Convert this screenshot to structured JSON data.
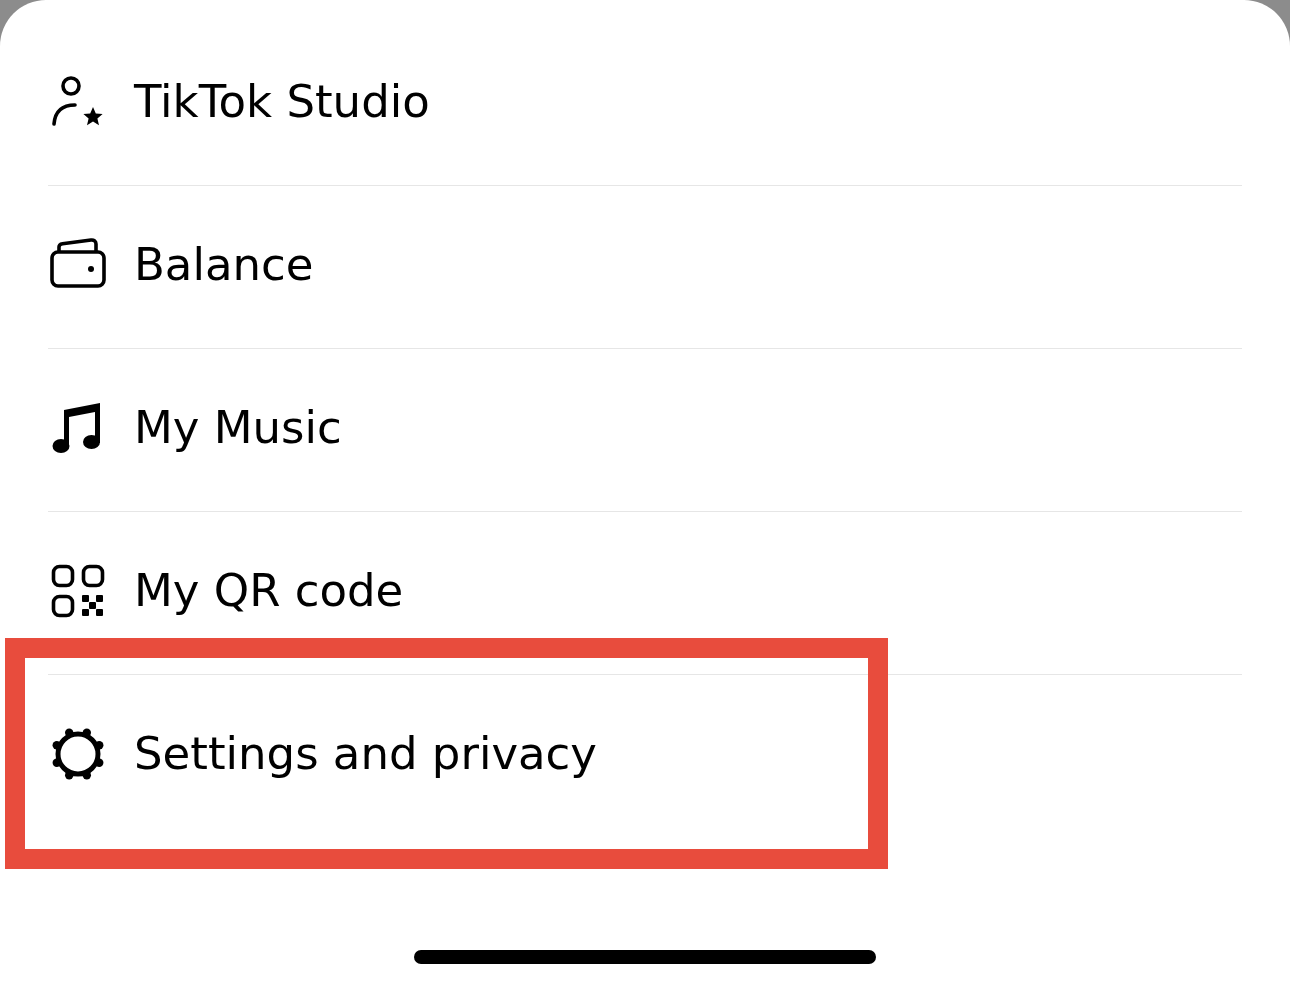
{
  "menu": [
    {
      "label": "TikTok Studio",
      "highlighted": false
    },
    {
      "label": "Balance",
      "highlighted": false
    },
    {
      "label": "My Music",
      "highlighted": false
    },
    {
      "label": "My QR code",
      "highlighted": false
    },
    {
      "label": "Settings and privacy",
      "highlighted": true
    }
  ]
}
